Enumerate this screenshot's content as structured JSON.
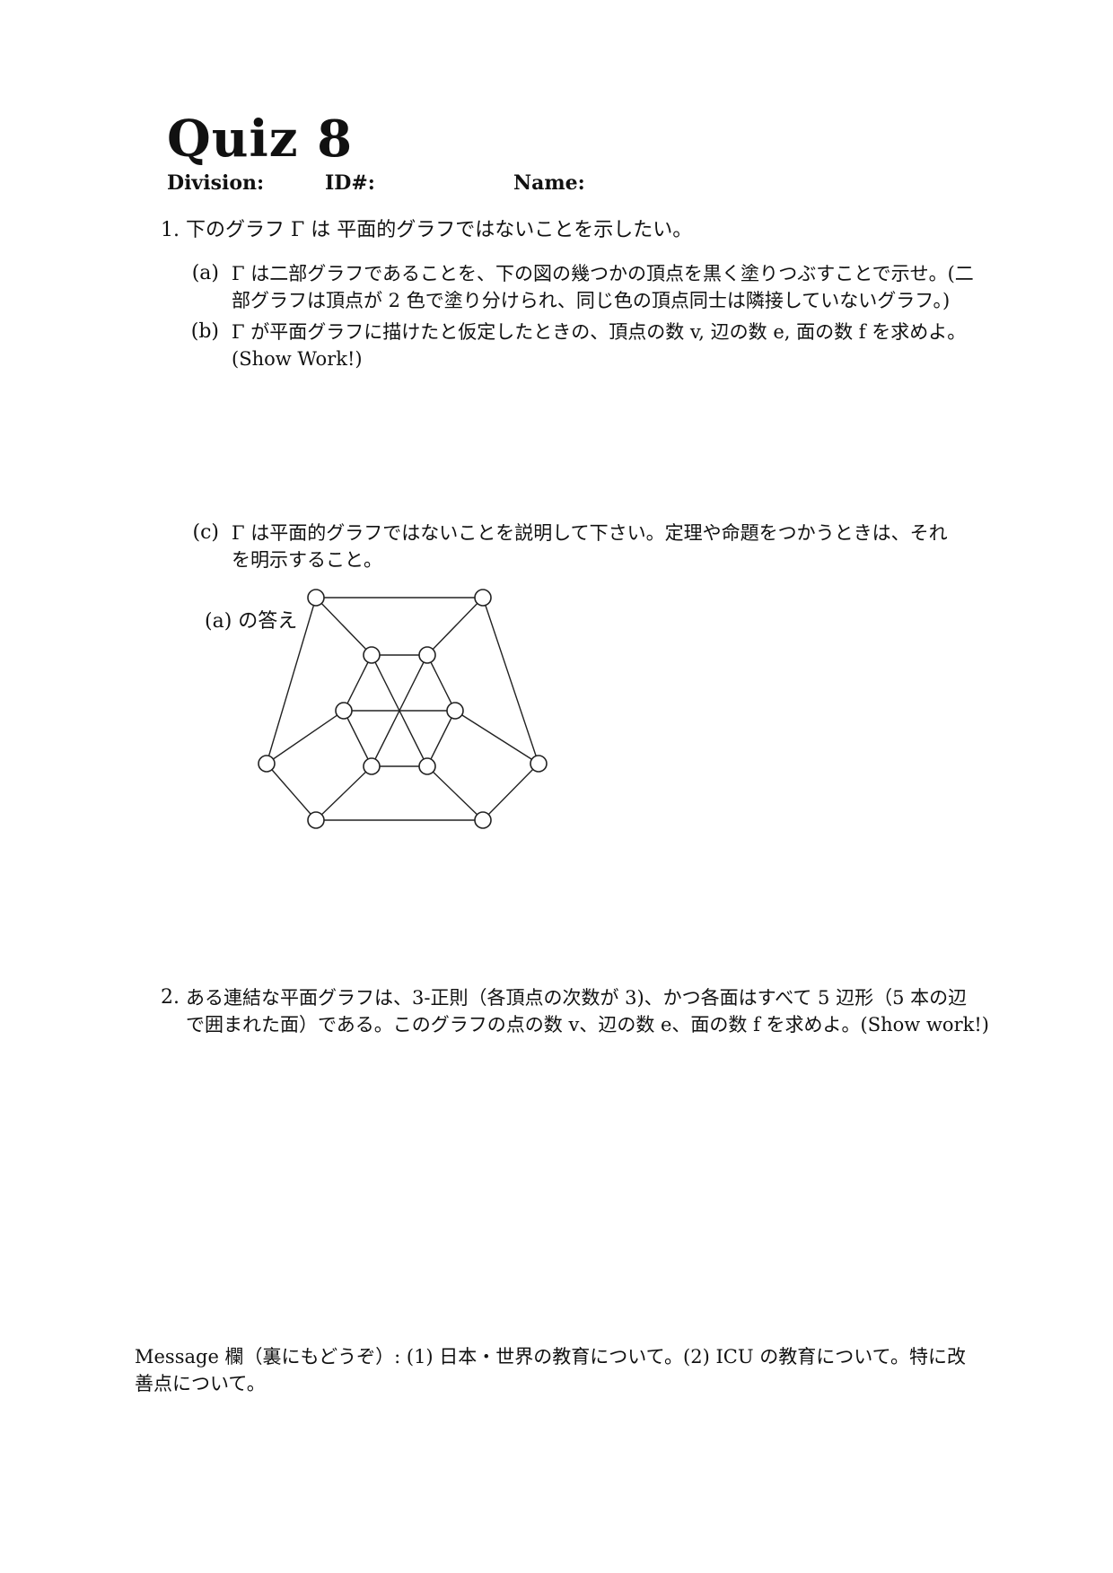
{
  "header": {
    "title": "Quiz 8",
    "division": "Division:",
    "id": "ID#:",
    "name": "Name:"
  },
  "q1": {
    "number": "1.",
    "text": "下のグラフ Γ は 平面的グラフではないことを示したい。",
    "a_label": "(a)",
    "a_line1": "Γ は二部グラフであることを、下の図の幾つかの頂点を黒く塗りつぶすことで示せ。(二",
    "a_line2": "部グラフは頂点が 2 色で塗り分けられ、同じ色の頂点同士は隣接していないグラフ。)",
    "b_label": "(b)",
    "b_line1": "Γ が平面グラフに描けたと仮定したときの、頂点の数 v, 辺の数 e, 面の数 f を求めよ。",
    "b_line2": "(Show Work!)",
    "c_label": "(c)",
    "c_line1": "Γ は平面的グラフではないことを説明して下さい。定理や命題をつかうときは、それ",
    "c_line2": "を明示すること。",
    "answer_label": "(a) の答え"
  },
  "q2": {
    "number": "2.",
    "line1": "ある連結な平面グラフは、3-正則（各頂点の次数が 3)、かつ各面はすべて 5 辺形（5 本の辺",
    "line2": "で囲まれた面）である。このグラフの点の数 v、辺の数 e、面の数 f を求めよ。(Show work!)"
  },
  "message": {
    "line1": "Message 欄（裏にもどうぞ）: (1) 日本・世界の教育について。(2) ICU の教育について。特に改",
    "line2": "善点について。"
  }
}
